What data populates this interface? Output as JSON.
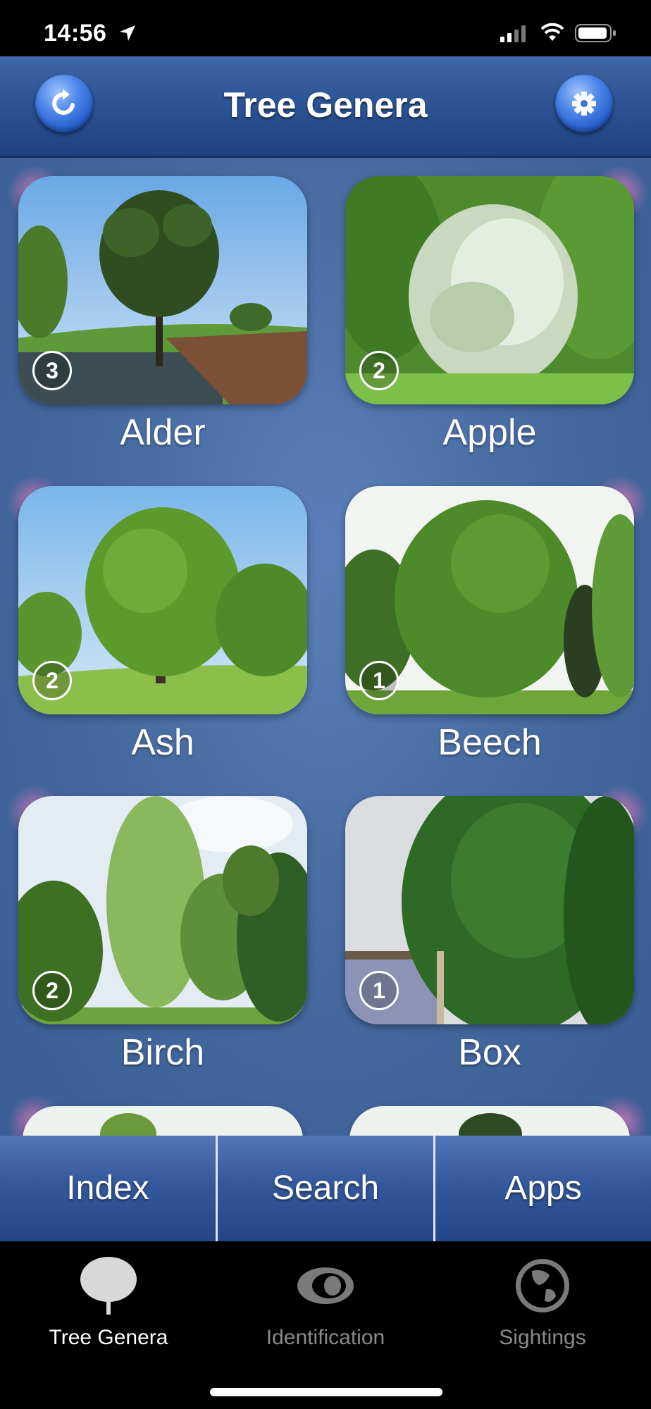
{
  "status_bar": {
    "time": "14:56"
  },
  "header": {
    "title": "Tree Genera"
  },
  "cards": [
    {
      "name": "Alder",
      "count": "3"
    },
    {
      "name": "Apple",
      "count": "2"
    },
    {
      "name": "Ash",
      "count": "2"
    },
    {
      "name": "Beech",
      "count": "1"
    },
    {
      "name": "Birch",
      "count": "2"
    },
    {
      "name": "Box",
      "count": "1"
    }
  ],
  "bottom_buttons": {
    "index": "Index",
    "search": "Search",
    "apps": "Apps"
  },
  "tabs": [
    {
      "label": "Tree Genera",
      "icon": "tree-icon"
    },
    {
      "label": "Identification",
      "icon": "leaf-icon"
    },
    {
      "label": "Sightings",
      "icon": "globe-icon"
    }
  ],
  "colors": {
    "header": "#2d5495",
    "accent_button": "#4a84e8",
    "background": "#46699f"
  }
}
